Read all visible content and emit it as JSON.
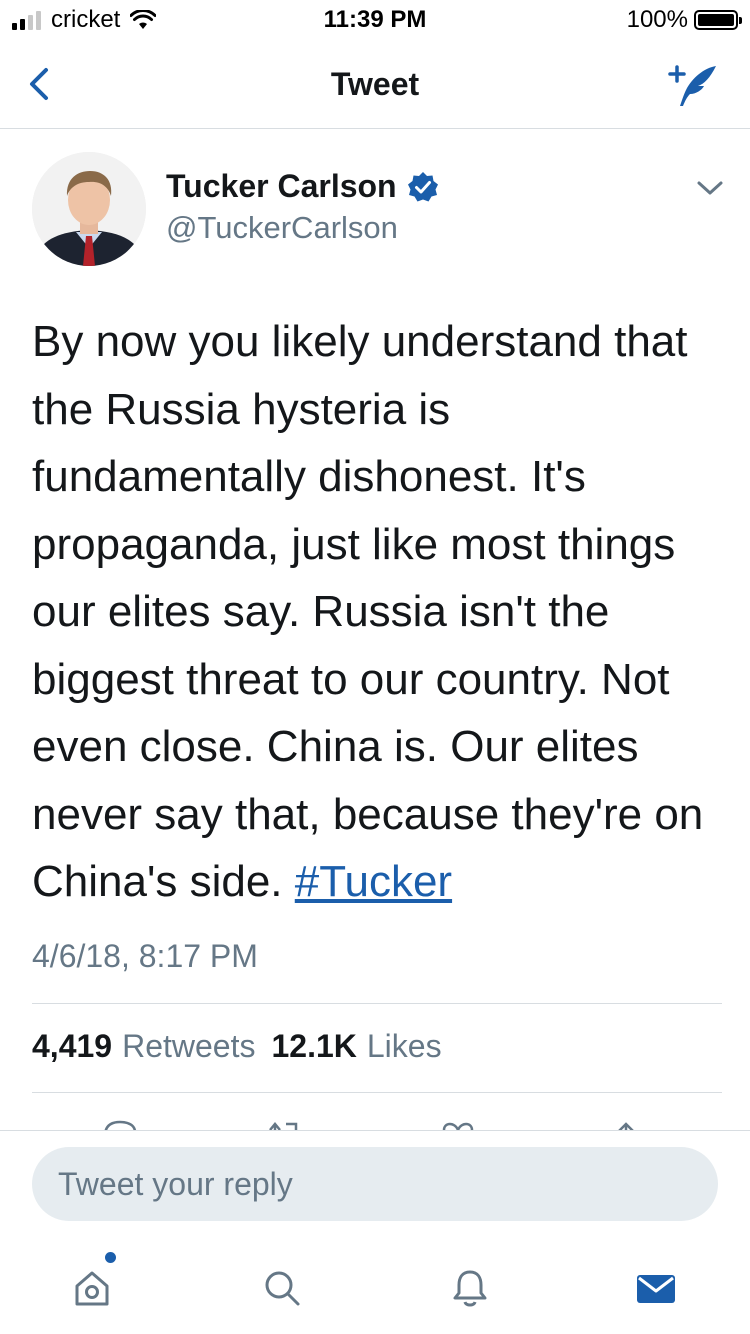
{
  "status_bar": {
    "carrier": "cricket",
    "time": "11:39 PM",
    "battery": "100%",
    "signal_bars_active": 2,
    "signal_bars_total": 4
  },
  "nav": {
    "title": "Tweet",
    "back_icon": "chevron-left-icon",
    "compose_icon": "compose-tweet-icon"
  },
  "tweet": {
    "author_name": "Tucker Carlson",
    "author_handle": "@TuckerCarlson",
    "verified": true,
    "text": "By now you likely understand that the Russia hysteria is fundamentally dishonest. It's propaganda, just like most things our elites say. Russia isn't the biggest threat to our country. Not even close. China is. Our elites never say that, because they're on China's side. ",
    "hashtag": "#Tucker",
    "timestamp": "4/6/18, 8:17 PM",
    "retweets_count": "4,419",
    "retweets_label": "Retweets",
    "likes_count": "12.1K",
    "likes_label": "Likes"
  },
  "reply": {
    "placeholder": "Tweet your reply"
  },
  "tab_bar": {
    "items": [
      "home-icon",
      "search-icon",
      "notifications-icon",
      "messages-icon"
    ],
    "home_has_badge": true
  },
  "colors": {
    "accent": "#1b5eab",
    "secondary_text": "#657786",
    "reply_bg": "#e6ecf0"
  }
}
